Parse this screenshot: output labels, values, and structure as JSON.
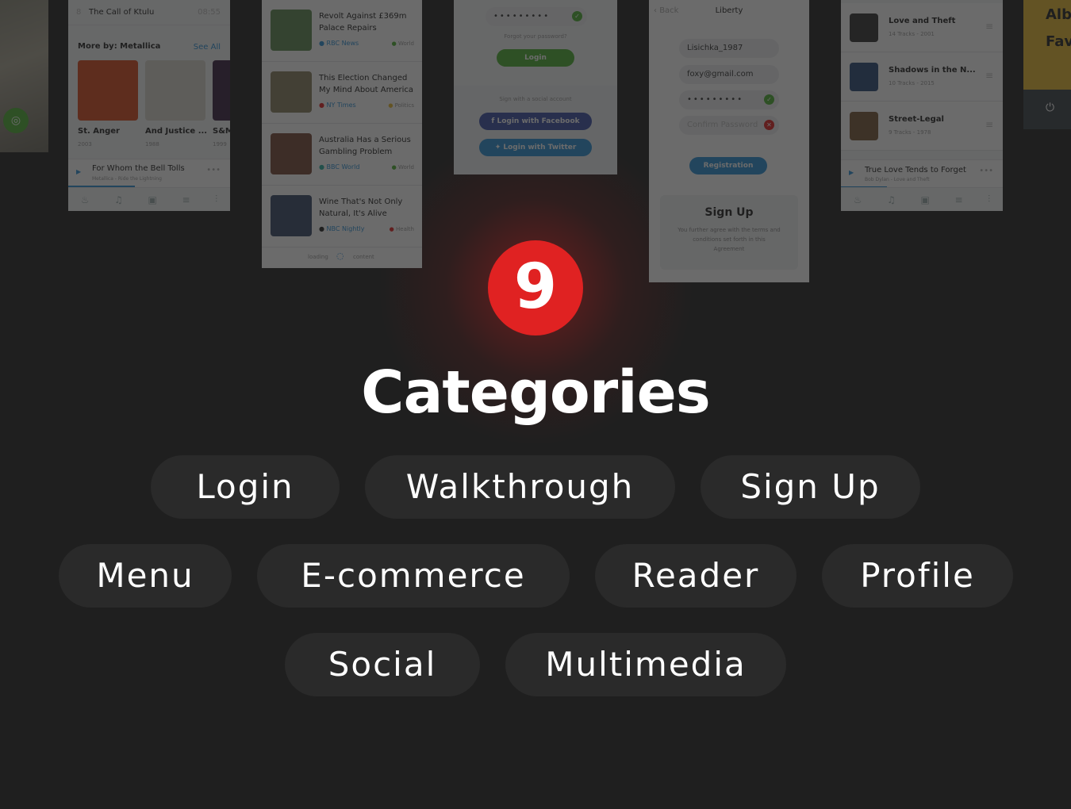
{
  "badge": {
    "number": "9"
  },
  "title": "Categories",
  "categories": [
    "Login",
    "Walkthrough",
    "Sign Up",
    "Menu",
    "E-commerce",
    "Reader",
    "Profile",
    "Social",
    "Multimedia"
  ],
  "colors": {
    "background": "#1f1f1f",
    "badge": "#e02222",
    "pill": "#2a2a2a",
    "accent_green": "#4caf32",
    "accent_blue": "#2a8fd6",
    "facebook": "#3b4fa8",
    "yellow": "#e8b830"
  },
  "music": {
    "track_num": "8",
    "track_title": "The Call of Ktulu",
    "track_time": "08:55",
    "more_by": "More by: Metallica",
    "see_all": "See All",
    "albums": [
      {
        "title": "St. Anger",
        "year": "2003"
      },
      {
        "title": "And Justice ...",
        "year": "1988"
      },
      {
        "title": "S&M",
        "year": "1999"
      }
    ],
    "now_playing": {
      "title": "For Whom the Bell Tolls",
      "subtitle": "Metallica - Ride the Lightning"
    }
  },
  "news": {
    "items": [
      {
        "title": "Revolt Against £369m Palace Repairs",
        "source": "RBC News",
        "category": "World"
      },
      {
        "title": "This Election Changed My Mind About America",
        "source": "NY Times",
        "category": "Politics"
      },
      {
        "title": "Australia Has a Serious Gambling Problem",
        "source": "BBC World",
        "category": "World"
      },
      {
        "title": "Wine That's Not Only Natural, It's Alive",
        "source": "NBC Nightly",
        "category": "Health"
      }
    ],
    "loading_left": "loading",
    "loading_right": "content"
  },
  "login": {
    "password": "•••••••••",
    "forgot": "Forgot your password?",
    "login_button": "Login",
    "social_label": "Sign with a social account",
    "facebook_button": "Login with Facebook",
    "twitter_button": "Login with Twitter"
  },
  "signup": {
    "back": "Back",
    "header": "Liberty",
    "username": "Lisichka_1987",
    "email": "foxy@gmail.com",
    "password": "•••••••••",
    "confirm_placeholder": "Confirm Password",
    "register_button": "Registration",
    "card_title": "Sign Up",
    "card_text": "You further agree with the terms and conditions set forth in this Agreement"
  },
  "albums": {
    "items": [
      {
        "title": "Love and Theft",
        "meta": "14 Tracks - 2001"
      },
      {
        "title": "Shadows in the N...",
        "meta": "10 Tracks - 2015"
      },
      {
        "title": "Street-Legal",
        "meta": "9 Tracks - 1978"
      }
    ],
    "now_playing": {
      "title": "True Love Tends to Forget",
      "subtitle": "Bob Dylan - Love and Theft"
    }
  },
  "menu_partial": {
    "line1": "Alb",
    "line2": "Fav"
  }
}
